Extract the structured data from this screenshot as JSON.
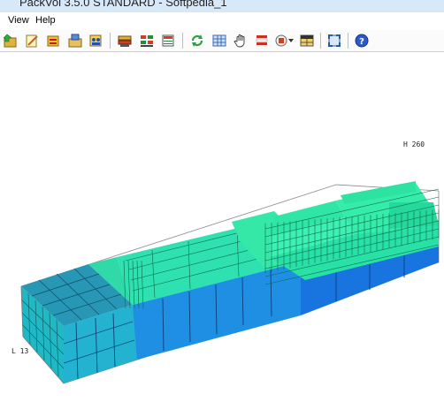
{
  "window": {
    "title": "PackVol 3.5.0 STANDARD - Softpedia_1"
  },
  "menu": {
    "items": [
      "View",
      "Help"
    ]
  },
  "toolbar": {
    "icons": [
      "open-icon",
      "edit-icon",
      "database-icon",
      "load-icon",
      "people-icon",
      "container-icon",
      "layout-icon",
      "report-icon",
      "refresh-icon",
      "grid-icon",
      "hand-icon",
      "stack-icon",
      "boxes-dropdown-icon",
      "table-icon",
      "fit-view-icon",
      "help-icon"
    ]
  },
  "viewport": {
    "height_label": "H 260",
    "length_label": "L 13",
    "colors": {
      "front_blue": "#1f8fe6",
      "side_teal": "#21b6c8",
      "top_green": "#2fe3a0",
      "grid_line": "#0b5a4a",
      "frame": "#888888"
    }
  }
}
